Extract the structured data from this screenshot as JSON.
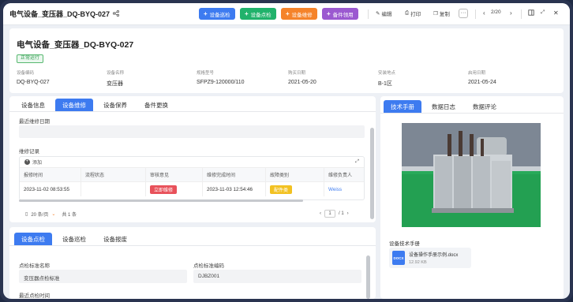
{
  "window": {
    "title": "电气设备_变压器_DQ-BYQ-027",
    "actions": [
      {
        "label": "设备巡检",
        "color": "#3d7bf0"
      },
      {
        "label": "设备点检",
        "color": "#20b26b"
      },
      {
        "label": "设备维修",
        "color": "#f5832a"
      },
      {
        "label": "备件领用",
        "color": "#9b59d0"
      }
    ],
    "tools": {
      "edit": "编辑",
      "print": "打印",
      "copy": "复制"
    },
    "pager": "2/20"
  },
  "header": {
    "title": "电气设备_变压器_DQ-BYQ-027",
    "status": "正常运行",
    "fields": [
      {
        "label": "设备编码",
        "value": "DQ-BYQ-027"
      },
      {
        "label": "设备名称",
        "value": "变压器"
      },
      {
        "label": "规格型号",
        "value": "SFPZ9-120000/110"
      },
      {
        "label": "购买日期",
        "value": "2021-05-20"
      },
      {
        "label": "安装地点",
        "value": "B-1区"
      },
      {
        "label": "启用日期",
        "value": "2021-05-24"
      }
    ]
  },
  "maintenance": {
    "tabs": [
      "设备信息",
      "设备维修",
      "设备保养",
      "备件更换"
    ],
    "last_repair_label": "最近维修日期",
    "records_label": "维修记录",
    "add_label": "添加",
    "columns": [
      "报修时间",
      "流程状态",
      "审核意见",
      "维修完成时间",
      "故障类别",
      "维修负责人"
    ],
    "rows": [
      {
        "report_time": "2023-11-02 08:53:55",
        "flow_status": "",
        "review": "立即维修",
        "finish_time": "2023-11-03 12:54:46",
        "fault_type": "配件类",
        "owner": "Weiss"
      }
    ],
    "page_size": "20 条/页",
    "total": "共 1 条",
    "page": "1",
    "page_total": "/ 1"
  },
  "inspection": {
    "tabs": [
      "设备点检",
      "设备巡检",
      "设备报废"
    ],
    "std_name_label": "点检标准名称",
    "std_name_value": "变压器点检标准",
    "std_code_label": "点检标准编码",
    "std_code_value": "DJBZ001",
    "last_check_label": "最近点检时间"
  },
  "manual": {
    "tabs": [
      "技术手册",
      "数据日志",
      "数据评论"
    ],
    "section_label": "设备技术手册",
    "file_name": "设备操作手册示例.docx",
    "file_size": "12.92 KB",
    "file_ext": "DOCX"
  }
}
